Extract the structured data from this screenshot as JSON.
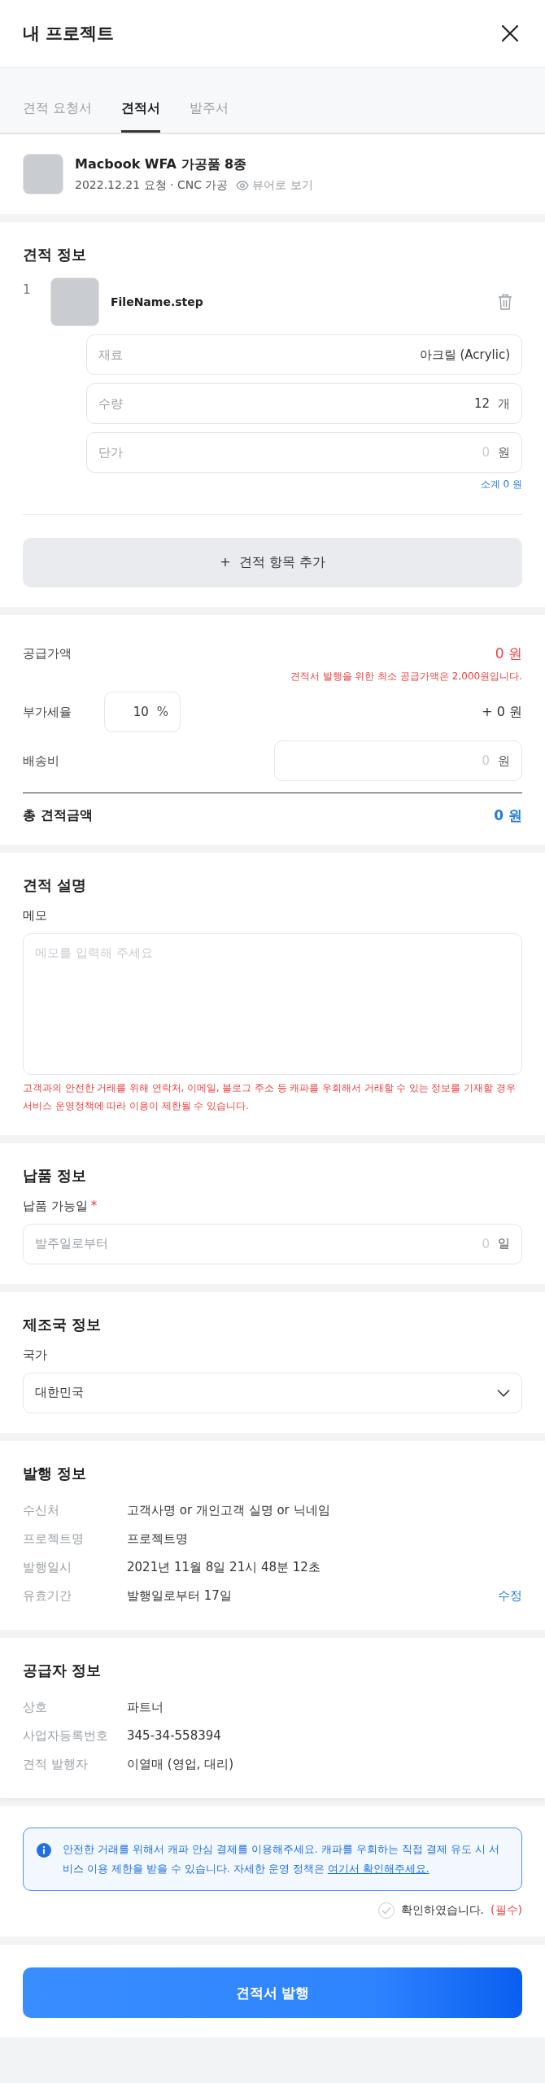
{
  "header": {
    "title": "내 프로젝트"
  },
  "tabs": [
    {
      "label": "견적 요청서",
      "selected": false
    },
    {
      "label": "견적서",
      "selected": true
    },
    {
      "label": "발주서",
      "selected": false
    }
  ],
  "project": {
    "title": "Macbook WFA 가공품 8종",
    "meta": "2022.12.21 요청 · CNC 가공",
    "viewer_link": "뷰어로 보기"
  },
  "quote_info": {
    "heading": "견적 정보",
    "items": [
      {
        "index": "1",
        "file_name": "FileName.step",
        "fields": [
          {
            "label": "재료",
            "value": "아크릴 (Acrylic)"
          },
          {
            "label": "수량",
            "value": "12",
            "unit": "개"
          },
          {
            "label": "단가",
            "placeholder": "0",
            "unit": "원"
          }
        ],
        "subtotal": "소계 0 원"
      }
    ],
    "add_button": "+  견적 항목 추가"
  },
  "summary": {
    "supply_label": "공급가액",
    "supply_value": "0 원",
    "supply_warning": "견적서 발행을 위한 최소 공급가액은 2,000원입니다.",
    "vat_label": "부가세율",
    "vat_input": {
      "value": "10",
      "unit": "%"
    },
    "vat_amount": "+ 0 원",
    "shipping_label": "배송비",
    "shipping_input": {
      "placeholder": "0",
      "unit": "원"
    },
    "total_label": "총 견적금액",
    "total_value": "0 원"
  },
  "description": {
    "heading": "견적 설명",
    "memo_label": "메모",
    "memo_placeholder": "메모를 입력해 주세요",
    "warning": "고객과의 안전한 거래를 위해 연락처, 이메일, 블로그 주소 등 캐파를 우회해서 거래할 수 있는 정보를 기재할 경우 서비스 운영정책에 따라 이용이 제한될 수 있습니다."
  },
  "delivery": {
    "heading": "납품 정보",
    "label": "납품 가능일",
    "required_mark": "*",
    "field": {
      "prefix": "발주일로부터",
      "placeholder": "0",
      "unit": "일"
    }
  },
  "country": {
    "heading": "제조국 정보",
    "label": "국가",
    "value": "대한민국"
  },
  "issue": {
    "heading": "발행 정보",
    "rows": [
      {
        "label": "수신처",
        "value": "고객사명 or 개인고객 실명 or 닉네임"
      },
      {
        "label": "프로젝트명",
        "value": "프로젝트명"
      },
      {
        "label": "발행일시",
        "value": "2021년 11월 8일 21시 48분 12초"
      },
      {
        "label": "유효기간",
        "value": "발행일로부터 17일",
        "action": "수정"
      }
    ]
  },
  "supplier": {
    "heading": "공급자 정보",
    "rows": [
      {
        "label": "상호",
        "value": "파트너"
      },
      {
        "label": "사업자등록번호",
        "value": "345-34-558394"
      },
      {
        "label": "견적 발행자",
        "value": "이열매 (영업, 대리)"
      }
    ]
  },
  "notice": {
    "text": "안전한 거래를 위해서 캐파 안심 결제를 이용해주세요. 캐파를 우회하는 직접 결제 유도 시 서비스 이용 제한을 받을 수 있습니다. 자세한 운영 정책은 ",
    "link": "여기서 확인해주세요."
  },
  "confirm": {
    "label": "확인하였습니다.",
    "required_note": "(필수)",
    "checked": false
  },
  "submit_button": "견적서 발행"
}
